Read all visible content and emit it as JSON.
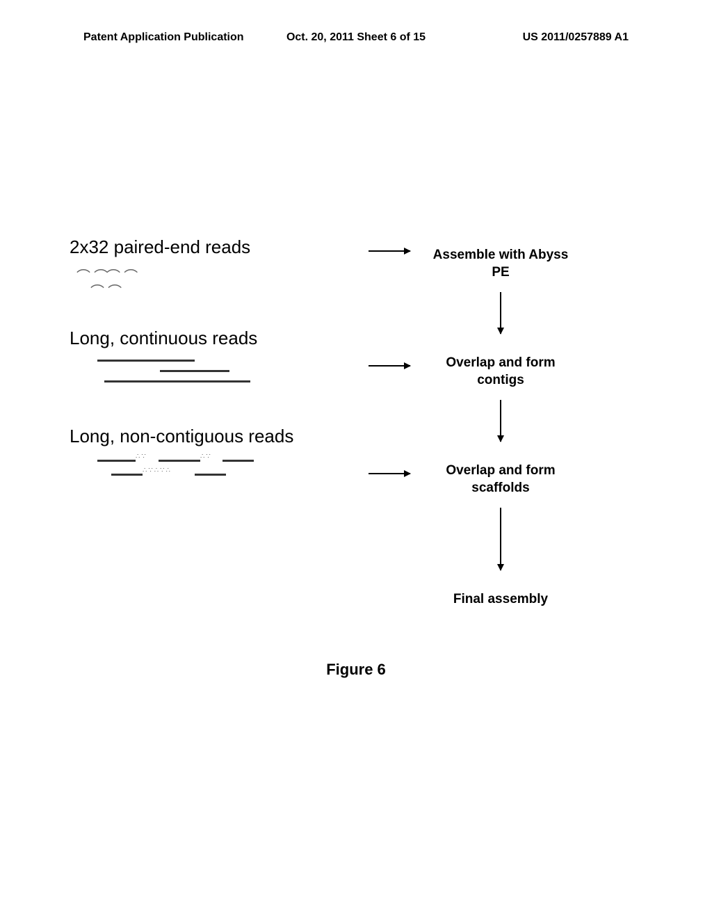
{
  "header": {
    "left": "Patent Application Publication",
    "center": "Oct. 20, 2011  Sheet 6 of 15",
    "right": "US 2011/0257889 A1"
  },
  "inputs": {
    "paired_end": {
      "title": "2x32 paired-end reads"
    },
    "continuous": {
      "title": "Long, continuous reads"
    },
    "noncontiguous": {
      "title": "Long, non-contiguous reads"
    }
  },
  "steps": {
    "assemble": "Assemble with Abyss PE",
    "contigs": "Overlap and form contigs",
    "scaffolds": "Overlap and form scaffolds",
    "final": "Final assembly"
  },
  "figure_caption": "Figure 6"
}
